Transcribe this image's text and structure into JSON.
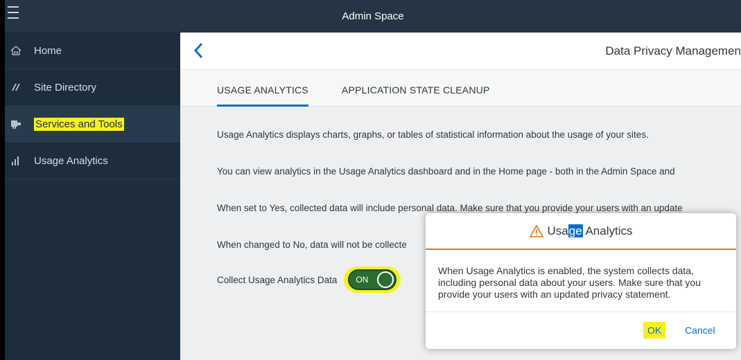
{
  "topbar": {
    "title": "Admin Space"
  },
  "sidebar": {
    "items": [
      {
        "label": "Home",
        "icon": "home-icon"
      },
      {
        "label": "Site Directory",
        "icon": "site-directory-icon"
      },
      {
        "label": "Services and Tools",
        "icon": "services-tools-icon",
        "selected": true
      },
      {
        "label": "Usage Analytics",
        "icon": "bar-chart-icon"
      }
    ]
  },
  "main": {
    "title": "Data Privacy Managemen",
    "tabs": [
      {
        "label": "USAGE ANALYTICS",
        "active": true
      },
      {
        "label": "APPLICATION STATE CLEANUP",
        "active": false
      }
    ],
    "paragraphs": [
      "Usage Analytics displays charts, graphs, or tables of statistical information about the usage of your sites.",
      "You can view analytics in the Usage Analytics dashboard and in the Home page - both in the Admin Space and",
      "When set to Yes, collected data will include personal data. Make sure that you provide your users with an update",
      "When changed to No, data will not be collecte"
    ],
    "collect_label": "Collect Usage Analytics Data",
    "switch_text": "ON"
  },
  "dialog": {
    "title_pre": "Usa",
    "title_hl": "ge",
    "title_post": " Analytics",
    "body": "When Usage Analytics is enabled, the system collects data, including personal data about your users. Make sure that you provide your users with an updated privacy statement.",
    "ok_label": "OK",
    "cancel_label": "Cancel"
  },
  "colors": {
    "shell": "#1d2d3e",
    "accent": "#0a6ed1",
    "warning": "#e9730c",
    "highlight": "#f6f01e",
    "switch_on": "#2b6c32"
  }
}
